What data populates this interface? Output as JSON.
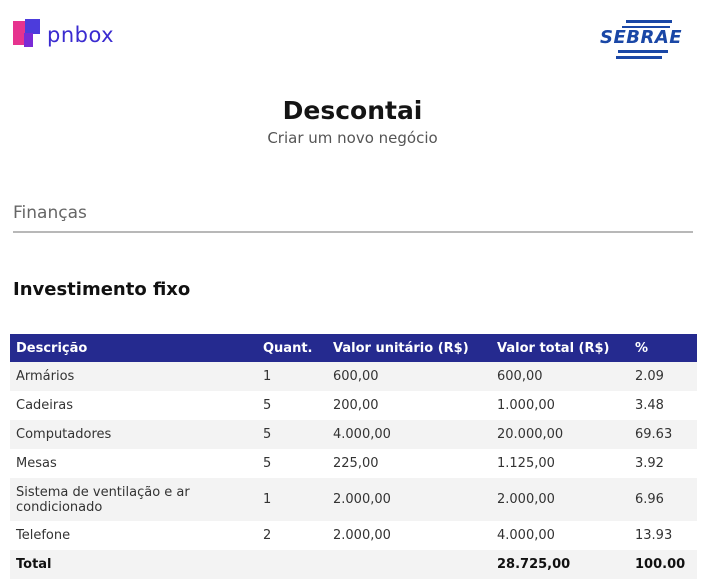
{
  "brand": {
    "left_logo": "pnbox",
    "right_logo": "SEBRAE"
  },
  "header": {
    "title": "Descontai",
    "subtitle": "Criar um novo negócio"
  },
  "section": {
    "label": "Finanças"
  },
  "investment": {
    "heading": "Investimento fixo",
    "columns": [
      "Descrição",
      "Quant.",
      "Valor unitário (R$)",
      "Valor total (R$)",
      "%"
    ],
    "rows": [
      {
        "descricao": "Armários",
        "quant": "1",
        "valor_unitario": "600,00",
        "valor_total": "600,00",
        "percent": "2.09"
      },
      {
        "descricao": "Cadeiras",
        "quant": "5",
        "valor_unitario": "200,00",
        "valor_total": "1.000,00",
        "percent": "3.48"
      },
      {
        "descricao": "Computadores",
        "quant": "5",
        "valor_unitario": "4.000,00",
        "valor_total": "20.000,00",
        "percent": "69.63"
      },
      {
        "descricao": "Mesas",
        "quant": "5",
        "valor_unitario": "225,00",
        "valor_total": "1.125,00",
        "percent": "3.92"
      },
      {
        "descricao": "Sistema de ventilação e ar condicionado",
        "quant": "1",
        "valor_unitario": "2.000,00",
        "valor_total": "2.000,00",
        "percent": "6.96"
      },
      {
        "descricao": "Telefone",
        "quant": "2",
        "valor_unitario": "2.000,00",
        "valor_total": "4.000,00",
        "percent": "13.93"
      }
    ],
    "total": {
      "label": "Total",
      "valor_total": "28.725,00",
      "percent": "100.00"
    }
  },
  "colors": {
    "header_bg": "#252a8f",
    "pnbox_blue": "#3a2bd0",
    "pnbox_pink": "#e6338f",
    "sebrae_blue": "#1a47a6"
  }
}
